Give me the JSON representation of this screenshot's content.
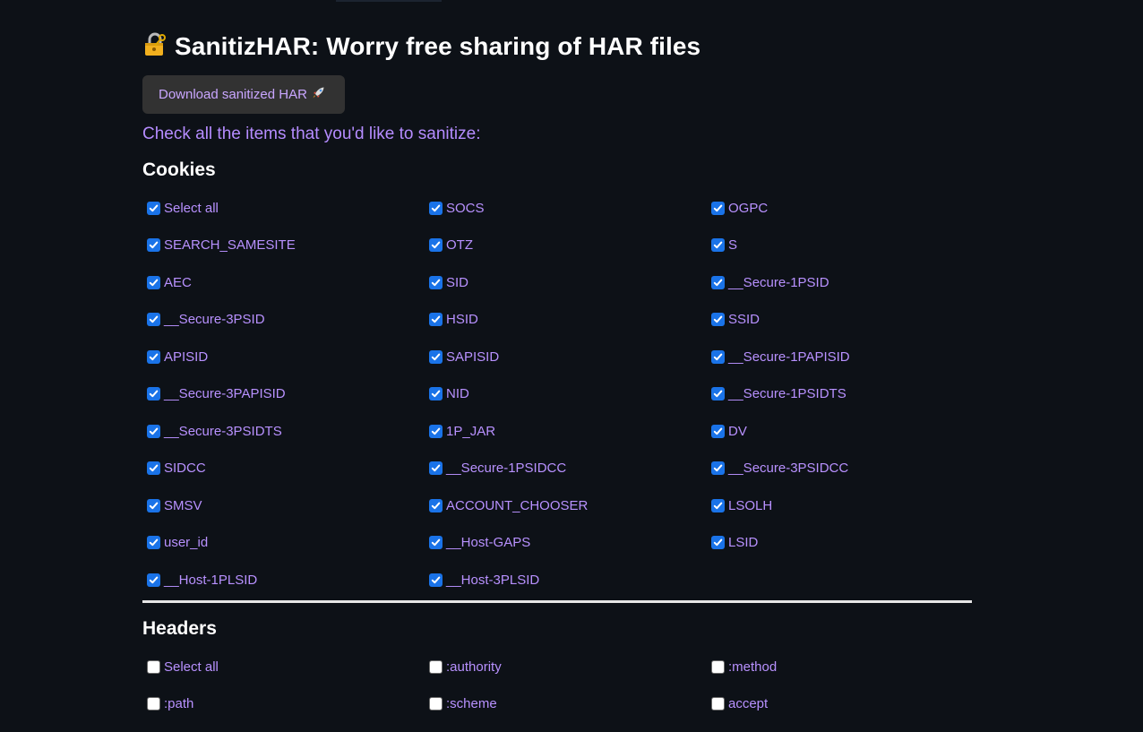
{
  "title": "SanitizHAR: Worry free sharing of HAR files",
  "download_button": "Download sanitized HAR",
  "instructions": "Check all the items that you'd like to sanitize:",
  "cookies": {
    "title": "Cookies",
    "items": [
      {
        "label": "Select all",
        "checked": true
      },
      {
        "label": "SOCS",
        "checked": true
      },
      {
        "label": "OGPC",
        "checked": true
      },
      {
        "label": "SEARCH_SAMESITE",
        "checked": true
      },
      {
        "label": "OTZ",
        "checked": true
      },
      {
        "label": "S",
        "checked": true
      },
      {
        "label": "AEC",
        "checked": true
      },
      {
        "label": "SID",
        "checked": true
      },
      {
        "label": "__Secure-1PSID",
        "checked": true
      },
      {
        "label": "__Secure-3PSID",
        "checked": true
      },
      {
        "label": "HSID",
        "checked": true
      },
      {
        "label": "SSID",
        "checked": true
      },
      {
        "label": "APISID",
        "checked": true
      },
      {
        "label": "SAPISID",
        "checked": true
      },
      {
        "label": "__Secure-1PAPISID",
        "checked": true
      },
      {
        "label": "__Secure-3PAPISID",
        "checked": true
      },
      {
        "label": "NID",
        "checked": true
      },
      {
        "label": "__Secure-1PSIDTS",
        "checked": true
      },
      {
        "label": "__Secure-3PSIDTS",
        "checked": true
      },
      {
        "label": "1P_JAR",
        "checked": true
      },
      {
        "label": "DV",
        "checked": true
      },
      {
        "label": "SIDCC",
        "checked": true
      },
      {
        "label": "__Secure-1PSIDCC",
        "checked": true
      },
      {
        "label": "__Secure-3PSIDCC",
        "checked": true
      },
      {
        "label": "SMSV",
        "checked": true
      },
      {
        "label": "ACCOUNT_CHOOSER",
        "checked": true
      },
      {
        "label": "LSOLH",
        "checked": true
      },
      {
        "label": "user_id",
        "checked": true
      },
      {
        "label": "__Host-GAPS",
        "checked": true
      },
      {
        "label": "LSID",
        "checked": true
      },
      {
        "label": "__Host-1PLSID",
        "checked": true
      },
      {
        "label": "__Host-3PLSID",
        "checked": true
      }
    ]
  },
  "headers": {
    "title": "Headers",
    "items": [
      {
        "label": "Select all",
        "checked": false
      },
      {
        "label": ":authority",
        "checked": false
      },
      {
        "label": ":method",
        "checked": false
      },
      {
        "label": ":path",
        "checked": false
      },
      {
        "label": ":scheme",
        "checked": false
      },
      {
        "label": "accept",
        "checked": false
      }
    ]
  },
  "colors": {
    "background": "#0d1117",
    "label": "#b891ff",
    "checkbox_checked": "#1a73e8",
    "button_bg": "#323232"
  },
  "icons": {
    "title_icon": "lock-with-key-icon",
    "button_icon": "rocket-icon"
  }
}
